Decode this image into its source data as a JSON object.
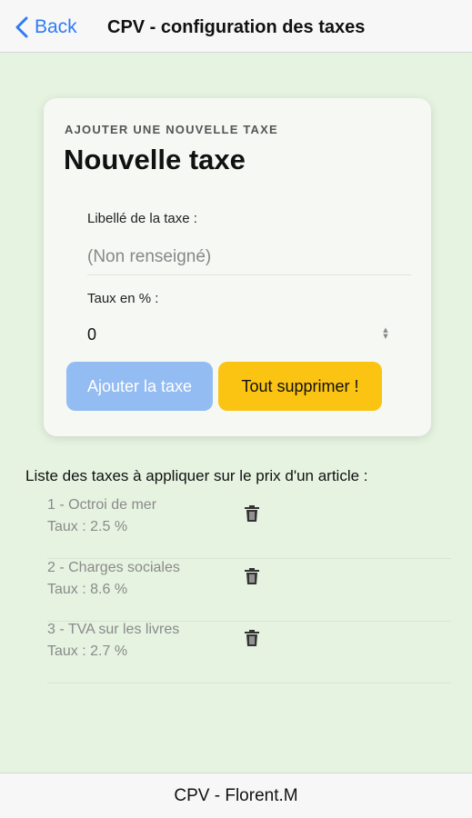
{
  "nav": {
    "back_label": "Back",
    "title": "CPV - configuration des taxes",
    "accent_color": "#2f7bf6"
  },
  "card": {
    "eyebrow": "AJOUTER UNE NOUVELLE TAXE",
    "title": "Nouvelle taxe",
    "label_field_label": "Libellé de la taxe :",
    "label_field_value": "",
    "label_field_placeholder": "(Non renseigné)",
    "rate_field_label": "Taux en % :",
    "rate_field_value": "0",
    "add_button_label": "Ajouter la taxe",
    "add_button_color": "#93bcf2",
    "delete_all_button_label": "Tout supprimer !",
    "delete_all_button_color": "#fbc312"
  },
  "list": {
    "title": "Liste des taxes à appliquer sur le prix d'un article :",
    "items": [
      {
        "name": "1 - Octroi de mer",
        "rate": "Taux : 2.5 %",
        "icon": "trash-icon"
      },
      {
        "name": "2 - Charges sociales",
        "rate": "Taux : 8.6 %",
        "icon": "trash-icon"
      },
      {
        "name": "3 - TVA sur les livres",
        "rate": "Taux : 2.7 %",
        "icon": "trash-icon"
      }
    ]
  },
  "footer": {
    "text": "CPV - Florent.M"
  },
  "colors": {
    "background": "#e6f3e1"
  }
}
